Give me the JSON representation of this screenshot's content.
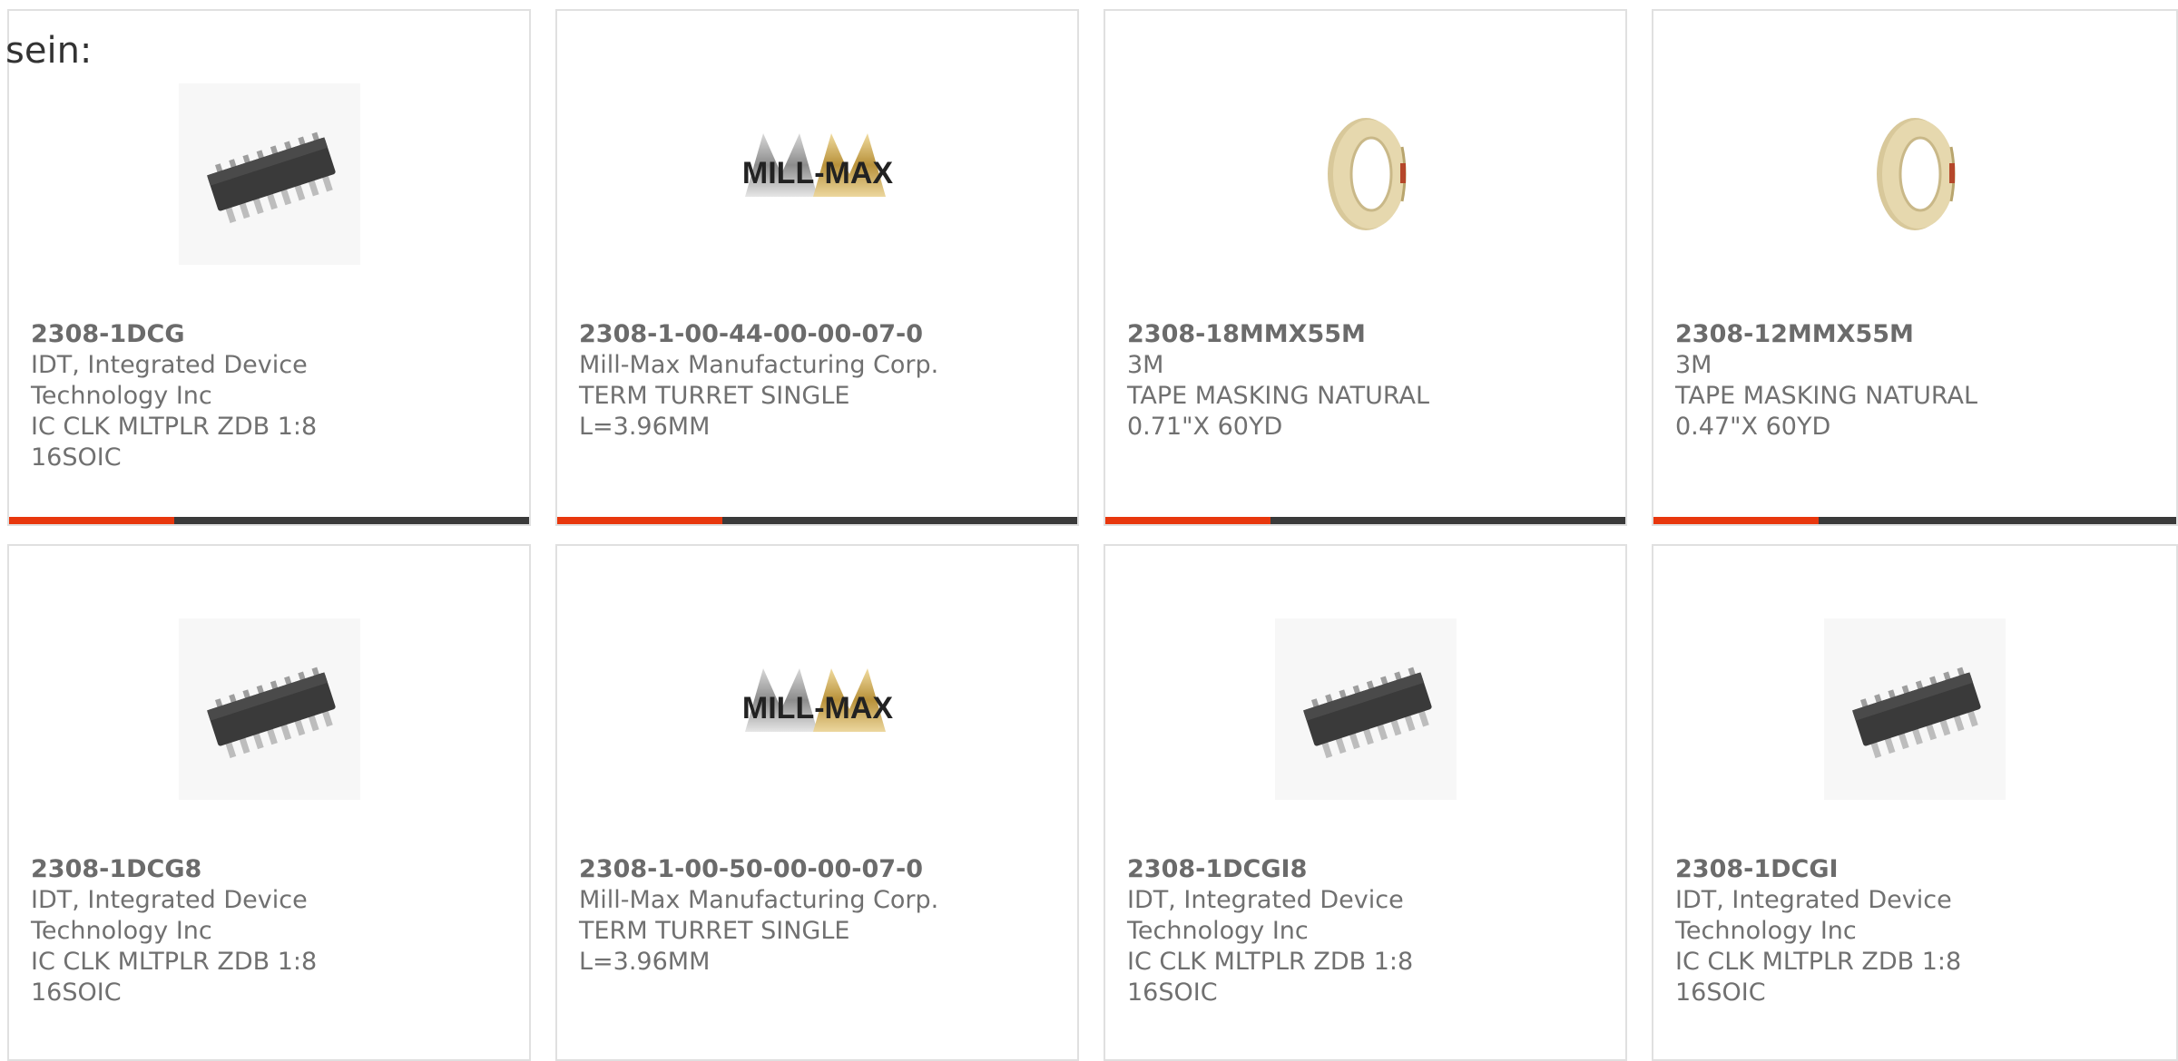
{
  "intro_text": "sein:",
  "colors": {
    "accent": "#e8370d",
    "bar": "#3a3a3a",
    "border": "#e0e0e0",
    "text": "#707070"
  },
  "products": [
    {
      "part_number": "2308-1DCG",
      "manufacturer": "IDT, Integrated Device Technology Inc",
      "description": "IC CLK MLTPLR ZDB 1:8 16SOIC",
      "image": "soic-chip-icon"
    },
    {
      "part_number": "2308-1-00-44-00-00-07-0",
      "manufacturer": "Mill-Max Manufacturing Corp.",
      "description": "TERM TURRET SINGLE L=3.96MM",
      "image": "mill-max-logo",
      "logo_text": "MILL-MAX"
    },
    {
      "part_number": "2308-18MMX55M",
      "manufacturer": "3M",
      "description": "TAPE MASKING NATURAL 0.71\"X 60YD",
      "image": "tape-roll-icon"
    },
    {
      "part_number": "2308-12MMX55M",
      "manufacturer": "3M",
      "description": "TAPE MASKING NATURAL 0.47\"X 60YD",
      "image": "tape-roll-icon"
    },
    {
      "part_number": "2308-1DCG8",
      "manufacturer": "IDT, Integrated Device Technology Inc",
      "description": "IC CLK MLTPLR ZDB 1:8 16SOIC",
      "image": "soic-chip-icon"
    },
    {
      "part_number": "2308-1-00-50-00-00-07-0",
      "manufacturer": "Mill-Max Manufacturing Corp.",
      "description": "TERM TURRET SINGLE L=3.96MM",
      "image": "mill-max-logo",
      "logo_text": "MILL-MAX"
    },
    {
      "part_number": "2308-1DCGI8",
      "manufacturer": "IDT, Integrated Device Technology Inc",
      "description": "IC CLK MLTPLR ZDB 1:8 16SOIC",
      "image": "soic-chip-icon"
    },
    {
      "part_number": "2308-1DCGI",
      "manufacturer": "IDT, Integrated Device Technology Inc",
      "description": "IC CLK MLTPLR ZDB 1:8 16SOIC",
      "image": "soic-chip-icon"
    }
  ]
}
